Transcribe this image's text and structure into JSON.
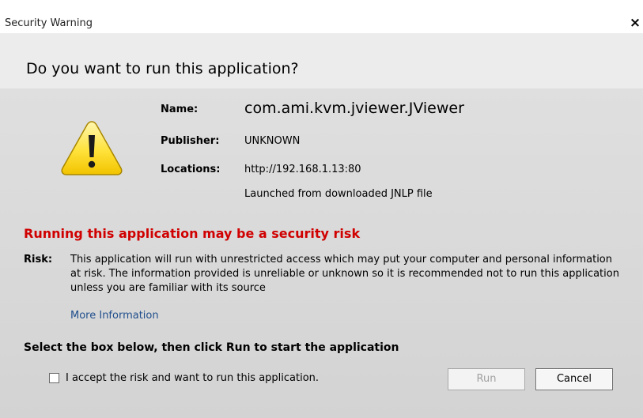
{
  "window": {
    "title": "Security Warning",
    "close_glyph": "×"
  },
  "header": {
    "headline": "Do you want to run this application?"
  },
  "details": {
    "icon": "warning-triangle-icon",
    "name_label": "Name:",
    "name_value": "com.ami.kvm.jviewer.JViewer",
    "publisher_label": "Publisher:",
    "publisher_value": "UNKNOWN",
    "locations_label": "Locations:",
    "location_url": "http://192.168.1.13:80",
    "location_note": "Launched from downloaded JNLP file"
  },
  "risk": {
    "heading": "Running this application may be a security risk",
    "label": "Risk:",
    "text": "This application will run with unrestricted access which may put your computer and personal information at risk. The information provided is unreliable or unknown so it is recommended not to run this application unless you are familiar with its source",
    "more_info_link": "More Information"
  },
  "confirm": {
    "instruction": "Select the box below, then click Run to start the application",
    "checkbox_label": "I accept the risk and want to run this application.",
    "checkbox_checked": false,
    "run_label": "Run",
    "run_enabled": false,
    "cancel_label": "Cancel"
  },
  "colors": {
    "risk_heading": "#d00000",
    "link": "#1f4e8c",
    "body_bg": "#d8d8d8",
    "header_bg": "#ececec"
  }
}
